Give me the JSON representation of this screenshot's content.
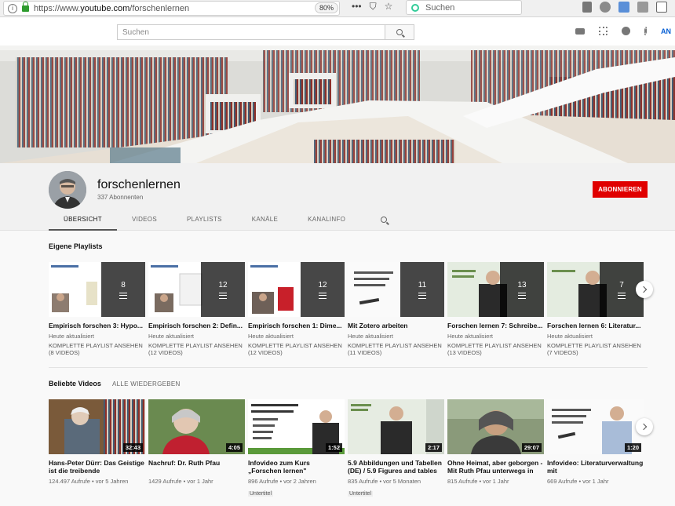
{
  "browser": {
    "url_prefix": "https://www.",
    "url_domain": "youtube.com",
    "url_path": "/forschenlernen",
    "zoom": "80%",
    "search_placeholder": "Suchen",
    "dots": "•••"
  },
  "header": {
    "search_placeholder": "Suchen",
    "signin": "AN"
  },
  "channel": {
    "name": "forschenlernen",
    "subscribers": "337 Abonnenten",
    "subscribe_label": "ABONNIEREN"
  },
  "tabs": [
    "ÜBERSICHT",
    "VIDEOS",
    "PLAYLISTS",
    "KANÄLE",
    "KANALINFO"
  ],
  "playlists_section": {
    "title": "Eigene Playlists",
    "items": [
      {
        "title": "Empirisch forschen 3: Hypo...",
        "count": "8",
        "updated": "Heute aktualisiert",
        "link": "KOMPLETTE PLAYLIST ANSEHEN (8 VIDEOS)"
      },
      {
        "title": "Empirisch forschen 2: Defin...",
        "count": "12",
        "updated": "Heute aktualisiert",
        "link": "KOMPLETTE PLAYLIST ANSEHEN (12 VIDEOS)"
      },
      {
        "title": "Empirisch forschen 1: Dime...",
        "count": "12",
        "updated": "Heute aktualisiert",
        "link": "KOMPLETTE PLAYLIST ANSEHEN (12 VIDEOS)"
      },
      {
        "title": "Mit Zotero arbeiten",
        "count": "11",
        "updated": "Heute aktualisiert",
        "link": "KOMPLETTE PLAYLIST ANSEHEN (11 VIDEOS)"
      },
      {
        "title": "Forschen lernen 7: Schreibe...",
        "count": "13",
        "updated": "Heute aktualisiert",
        "link": "KOMPLETTE PLAYLIST ANSEHEN (13 VIDEOS)"
      },
      {
        "title": "Forschen lernen 6: Literatur...",
        "count": "7",
        "updated": "Heute aktualisiert",
        "link": "KOMPLETTE PLAYLIST ANSEHEN (7 VIDEOS)"
      }
    ]
  },
  "videos_section": {
    "title": "Beliebte Videos",
    "play_all": "ALLE WIEDERGEBEN",
    "items": [
      {
        "title": "Hans-Peter Dürr: Das Geistige ist die treibende",
        "duration": "32:43",
        "views": "124.497 Aufrufe • vor 5 Jahren",
        "badge": ""
      },
      {
        "title": "Nachruf: Dr. Ruth Pfau",
        "duration": "4:05",
        "views": "1429 Aufrufe • vor 1 Jahr",
        "badge": ""
      },
      {
        "title": "Infovideo zum Kurs „Forschen lernen\"",
        "duration": "1:52",
        "views": "896 Aufrufe • vor 2 Jahren",
        "badge": "Untertitel"
      },
      {
        "title": "5.9 Abbildungen und Tabellen (DE) / 5.9 Figures and tables",
        "duration": "2:17",
        "views": "835 Aufrufe • vor 5 Monaten",
        "badge": "Untertitel"
      },
      {
        "title": "Ohne Heimat, aber geborgen - Mit Ruth Pfau unterwegs in",
        "duration": "29:07",
        "views": "815 Aufrufe • vor 1 Jahr",
        "badge": ""
      },
      {
        "title": "Infovideo: Literaturverwaltung mit",
        "duration": "1:20",
        "views": "669 Aufrufe • vor 1 Jahr",
        "badge": ""
      }
    ]
  },
  "colors": {
    "subscribe": "#e00000",
    "link_blue": "#065fd4"
  }
}
